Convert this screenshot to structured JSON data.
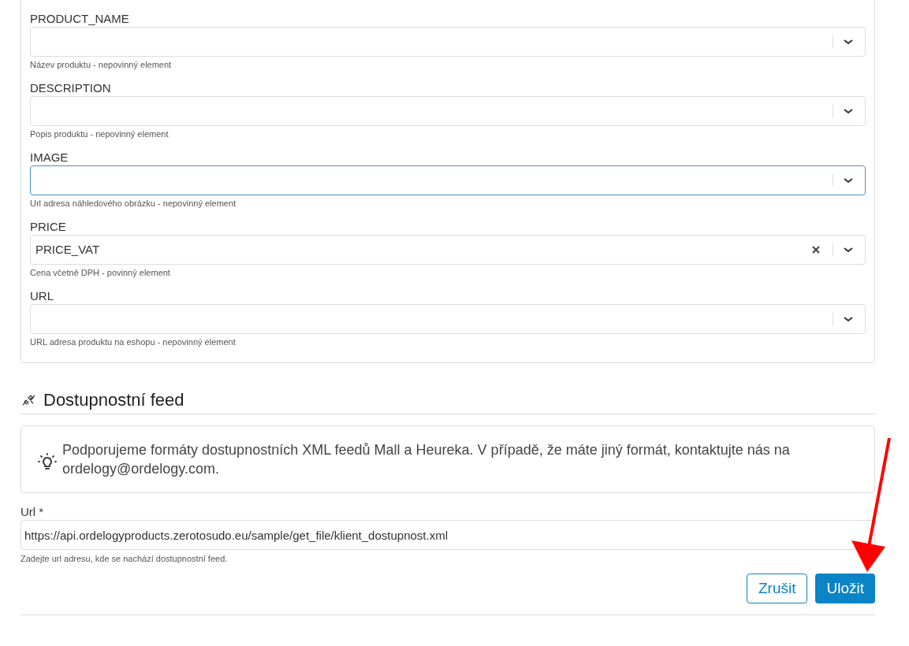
{
  "mapping_fields": [
    {
      "label": "PRODUCT_NAME",
      "focused": false,
      "hint": "Název produktu - nepovinný element"
    },
    {
      "label": "DESCRIPTION",
      "focused": false,
      "hint": "Popis produktu - nepovinný element"
    },
    {
      "label": "IMAGE",
      "focused": true,
      "hint": "Url adresa náhledového obrázku - nepovinný element"
    },
    {
      "label": "PRICE",
      "value": "PRICE_VAT",
      "focused": false,
      "hint": "Cena včetně DPH - povinný element"
    },
    {
      "label": "URL",
      "focused": false,
      "hint": "URL adresa produktu na eshopu - nepovinný element"
    }
  ],
  "section": {
    "title": "Dostupnostní feed",
    "info": "Podporujeme formáty dostupnostních XML feedů Mall a Heureka. V případě, že máte jiný formát, kontaktujte nás na ordelogy@ordelogy.com."
  },
  "url_field": {
    "label": "Url *",
    "value": "https://api.ordelogyproducts.zerotosudo.eu/sample/get_file/klient_dostupnost.xml",
    "hint": "Zadejte url adresu, kde se nachází dostupnostní feed."
  },
  "buttons": {
    "cancel": "Zrušit",
    "save": "Uložit"
  }
}
